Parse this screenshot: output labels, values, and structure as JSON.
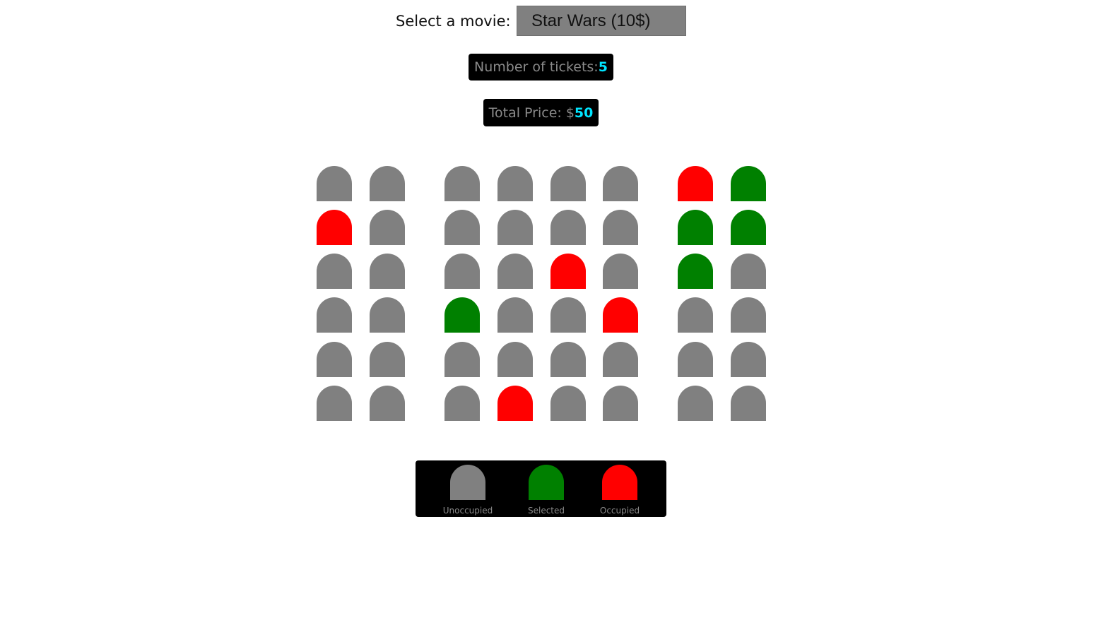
{
  "movie": {
    "label": "Select a movie:",
    "selected": "Star Wars (10$)"
  },
  "tickets": {
    "label": "Number of tickets:",
    "count": "5"
  },
  "price": {
    "label": "Total Price: $",
    "total": "50"
  },
  "seat_colors": {
    "unoccupied": "#808080",
    "selected": "#008000",
    "occupied": "#ff0000"
  },
  "seats": [
    [
      "unoccupied",
      "unoccupied",
      "unoccupied",
      "unoccupied",
      "unoccupied",
      "unoccupied",
      "occupied",
      "selected"
    ],
    [
      "occupied",
      "unoccupied",
      "unoccupied",
      "unoccupied",
      "unoccupied",
      "unoccupied",
      "selected",
      "selected"
    ],
    [
      "unoccupied",
      "unoccupied",
      "unoccupied",
      "unoccupied",
      "occupied",
      "unoccupied",
      "selected",
      "unoccupied"
    ],
    [
      "unoccupied",
      "unoccupied",
      "selected",
      "unoccupied",
      "unoccupied",
      "occupied",
      "unoccupied",
      "unoccupied"
    ],
    [
      "unoccupied",
      "unoccupied",
      "unoccupied",
      "unoccupied",
      "unoccupied",
      "unoccupied",
      "unoccupied",
      "unoccupied"
    ],
    [
      "unoccupied",
      "unoccupied",
      "unoccupied",
      "occupied",
      "unoccupied",
      "unoccupied",
      "unoccupied",
      "unoccupied"
    ]
  ],
  "legend": {
    "unoccupied": "Unoccupied",
    "selected": "Selected",
    "occupied": "Occupied"
  }
}
